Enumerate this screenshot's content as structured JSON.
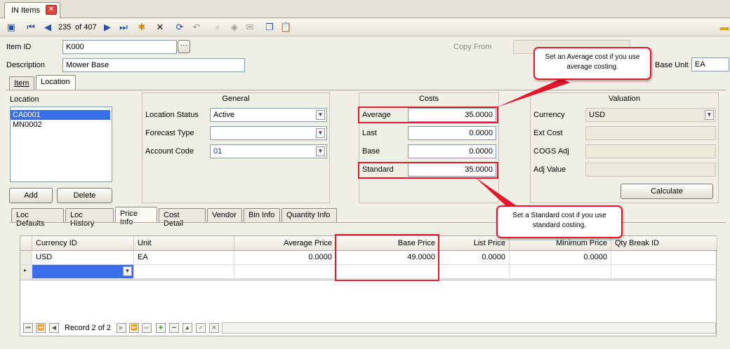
{
  "window": {
    "tab_title": "IN Items",
    "close_label": "✕"
  },
  "toolbar": {
    "current_record": "235",
    "of_total": "of 407"
  },
  "form": {
    "item_id_label": "Item ID",
    "item_id_value": "K000",
    "description_label": "Description",
    "description_value": "Mower Base",
    "copy_from_label": "Copy From",
    "copy_from_value": "",
    "base_unit_label": "Base Unit",
    "base_unit_value": "EA"
  },
  "top_tabs": [
    "Item",
    "Location"
  ],
  "location": {
    "title": "Location",
    "items": [
      "CA0001",
      "MN0002"
    ],
    "add_label": "Add",
    "delete_label": "Delete"
  },
  "general": {
    "title": "General",
    "location_status_label": "Location Status",
    "location_status_value": "Active",
    "forecast_type_label": "Forecast Type",
    "forecast_type_value": "",
    "account_code_label": "Account Code",
    "account_code_value": "01"
  },
  "costs": {
    "title": "Costs",
    "average_label": "Average",
    "average_value": "35.0000",
    "last_label": "Last",
    "last_value": "0.0000",
    "base_label": "Base",
    "base_value": "0.0000",
    "standard_label": "Standard",
    "standard_value": "35.0000"
  },
  "valuation": {
    "title": "Valuation",
    "currency_label": "Currency",
    "currency_value": "USD",
    "ext_cost_label": "Ext Cost",
    "cogs_adj_label": "COGS Adj",
    "adj_value_label": "Adj Value",
    "calculate_label": "Calculate"
  },
  "sub_tabs": [
    "Loc Defaults",
    "Loc History",
    "Price Info",
    "Cost Detail",
    "Vendor",
    "Bin Info",
    "Quantity Info"
  ],
  "grid": {
    "headers": [
      "Currency ID",
      "Unit",
      "Average Price",
      "Base Price",
      "List Price",
      "Minimum Price",
      "Qty Break ID"
    ],
    "row": {
      "currency": "USD",
      "unit": "EA",
      "average_price": "0.0000",
      "base_price": "49.0000",
      "list_price": "0.0000",
      "minimum_price": "0.0000",
      "qty_break": ""
    },
    "record_text": "Record 2 of 2"
  },
  "callouts": {
    "average": "Set an Average cost if you use average costing.",
    "standard": "Set a Standard cost if you use standard costing."
  },
  "colors": {
    "highlight": "#e2182c",
    "selection": "#3a6ee8"
  }
}
